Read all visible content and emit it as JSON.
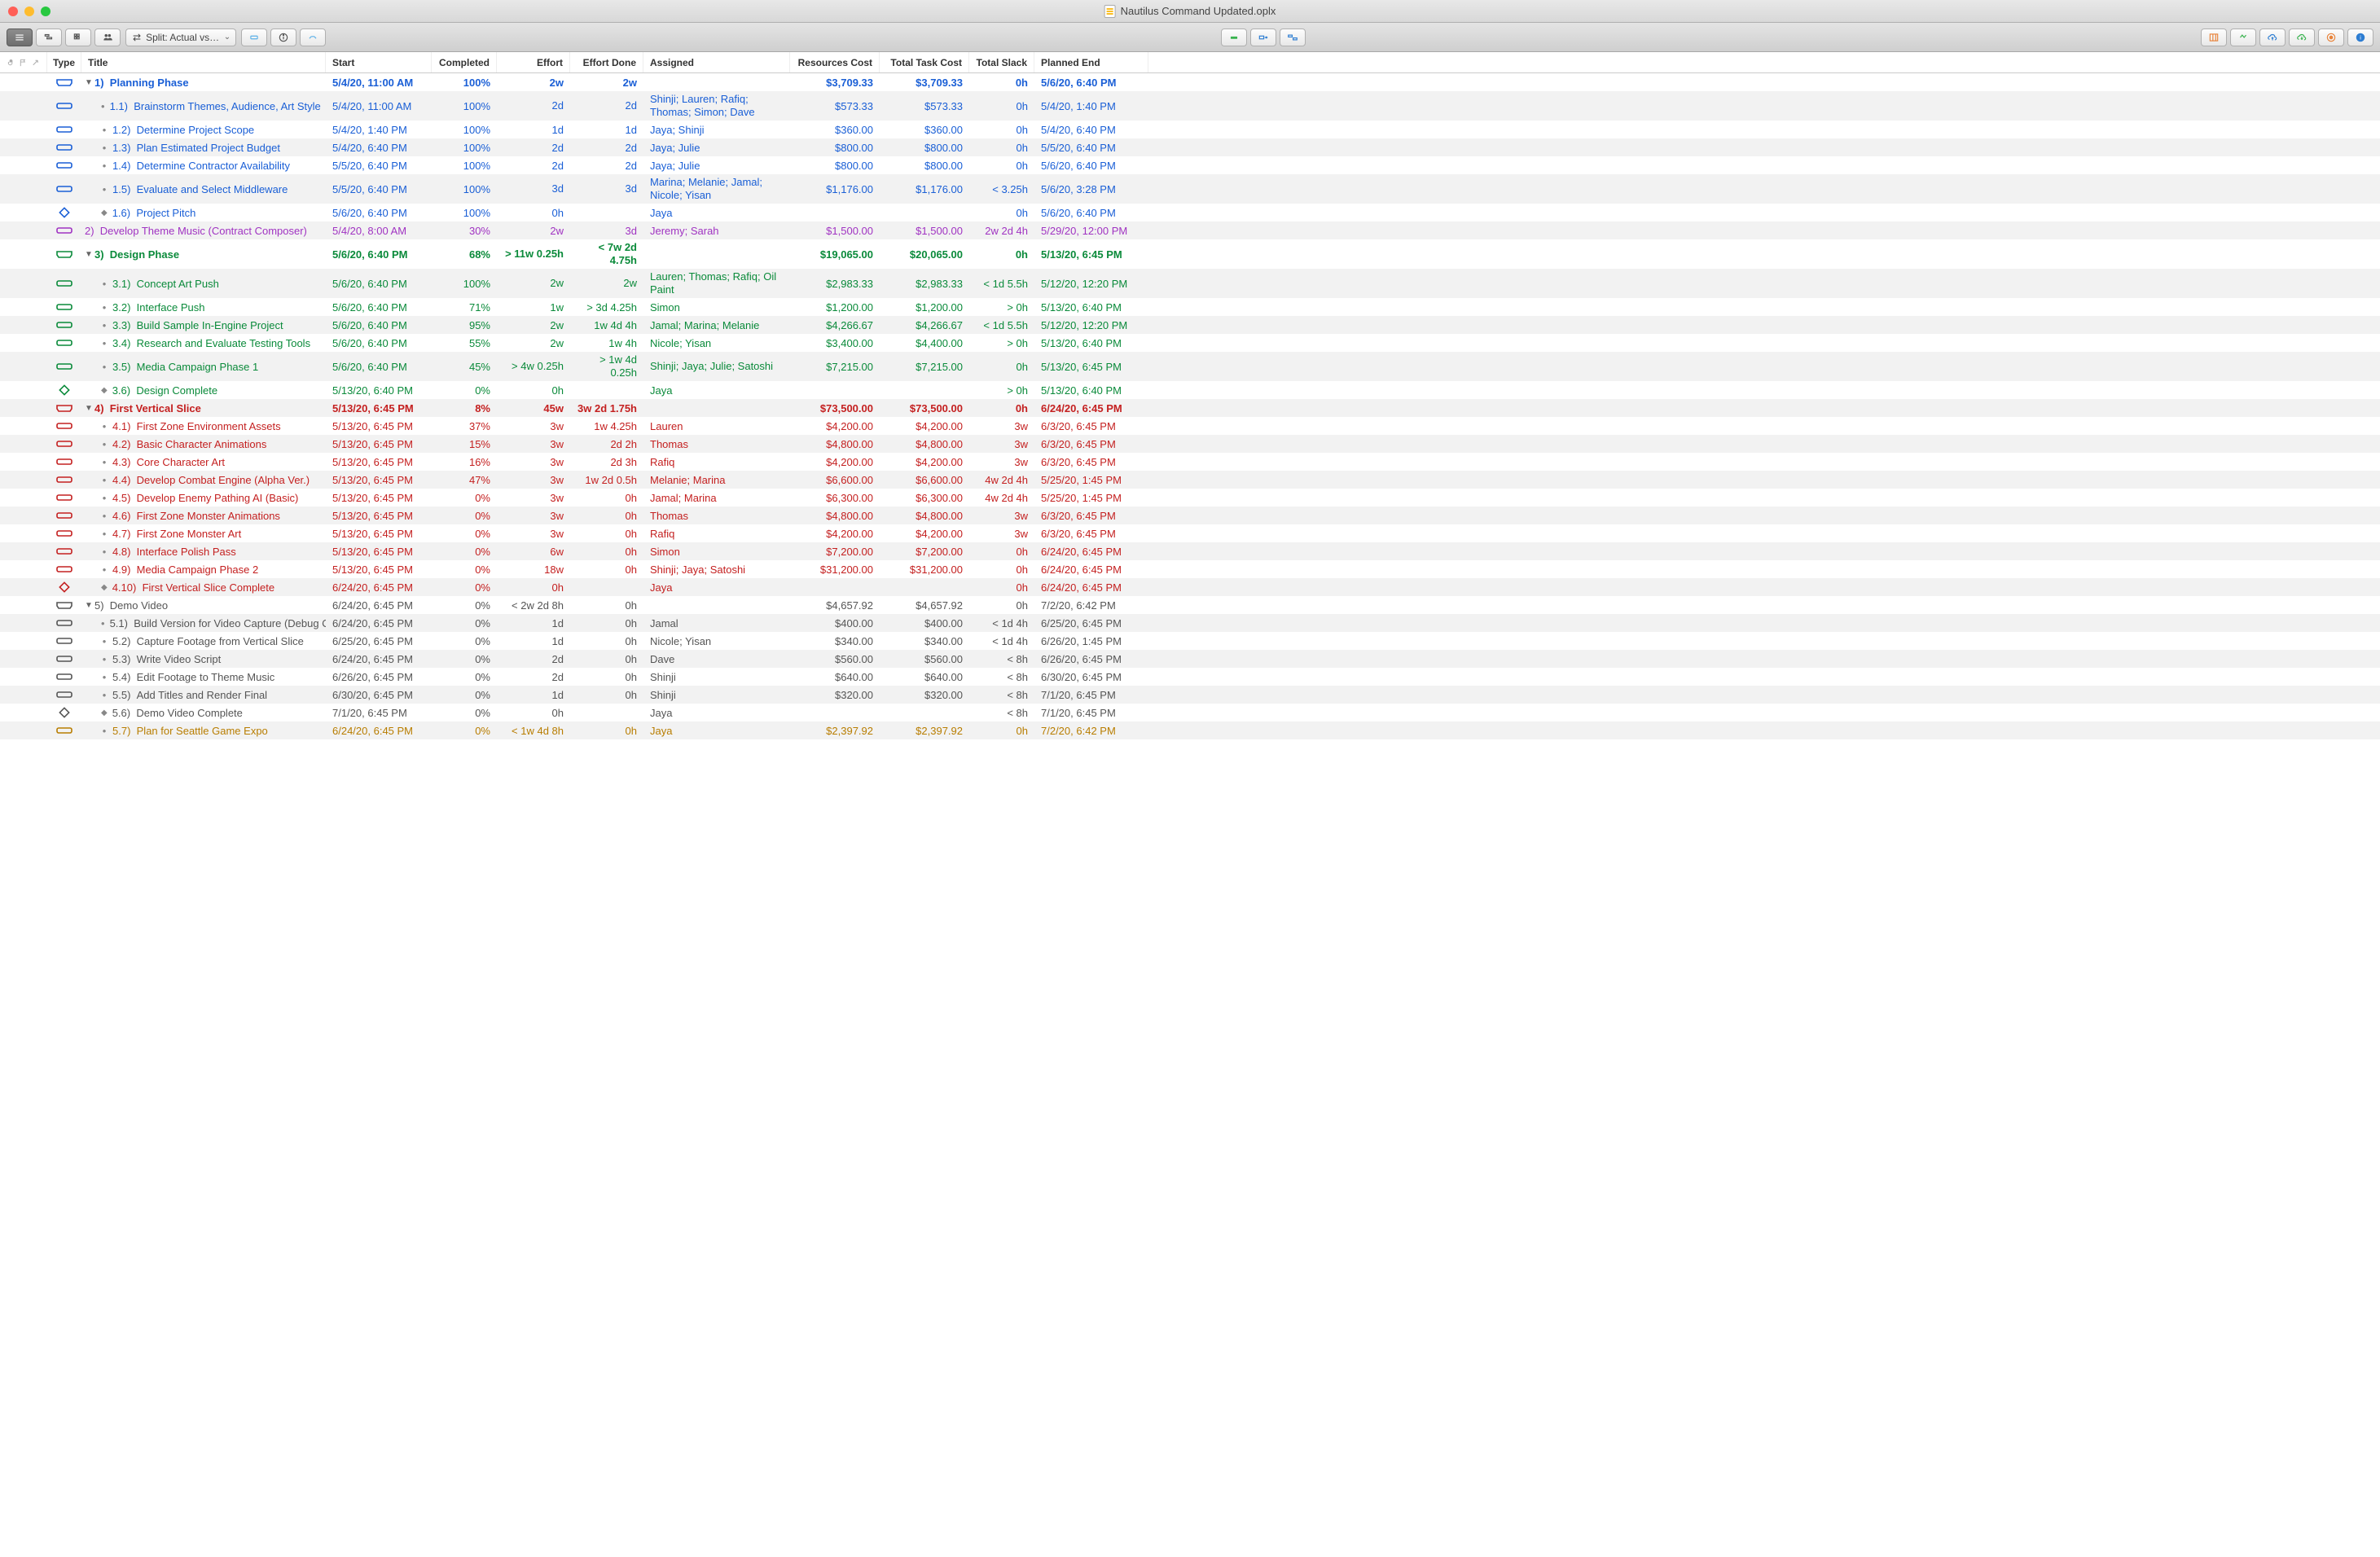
{
  "window": {
    "title": "Nautilus Command Updated.oplx"
  },
  "toolbar": {
    "split_label": "Split: Actual vs…"
  },
  "columns": {
    "type": "Type",
    "title": "Title",
    "start": "Start",
    "completed": "Completed",
    "effort": "Effort",
    "effort_done": "Effort Done",
    "assigned": "Assigned",
    "resources_cost": "Resources Cost",
    "total_task_cost": "Total Task Cost",
    "total_slack": "Total Slack",
    "planned_end": "Planned End"
  },
  "rows": [
    {
      "id": "1",
      "kind": "group",
      "color": "blue",
      "bold": true,
      "level": 1,
      "disclosure": "down",
      "number": "1)",
      "title": "Planning Phase",
      "start": "5/4/20, 11:00 AM",
      "completed": "100%",
      "effort": "2w",
      "effort_done": "2w",
      "assigned": "",
      "res_cost": "$3,709.33",
      "task_cost": "$3,709.33",
      "slack": "0h",
      "end": "5/6/20, 6:40 PM",
      "tall": false
    },
    {
      "id": "1.1",
      "kind": "task",
      "color": "blue",
      "level": 2,
      "bullet": "dot",
      "number": "1.1)",
      "title": "Brainstorm Themes, Audience, Art Style",
      "start": "5/4/20, 11:00 AM",
      "completed": "100%",
      "effort": "2d",
      "effort_done": "2d",
      "assigned": "Shinji; Lauren; Rafiq; Thomas; Simon; Dave",
      "res_cost": "$573.33",
      "task_cost": "$573.33",
      "slack": "0h",
      "end": "5/4/20, 1:40 PM",
      "tall": true
    },
    {
      "id": "1.2",
      "kind": "task",
      "color": "blue",
      "level": 2,
      "bullet": "dot",
      "number": "1.2)",
      "title": "Determine Project Scope",
      "start": "5/4/20, 1:40 PM",
      "completed": "100%",
      "effort": "1d",
      "effort_done": "1d",
      "assigned": "Jaya; Shinji",
      "res_cost": "$360.00",
      "task_cost": "$360.00",
      "slack": "0h",
      "end": "5/4/20, 6:40 PM",
      "tall": false
    },
    {
      "id": "1.3",
      "kind": "task",
      "color": "blue",
      "level": 2,
      "bullet": "dot",
      "number": "1.3)",
      "title": "Plan Estimated Project Budget",
      "start": "5/4/20, 6:40 PM",
      "completed": "100%",
      "effort": "2d",
      "effort_done": "2d",
      "assigned": "Jaya; Julie",
      "res_cost": "$800.00",
      "task_cost": "$800.00",
      "slack": "0h",
      "end": "5/5/20, 6:40 PM",
      "tall": false
    },
    {
      "id": "1.4",
      "kind": "task",
      "color": "blue",
      "level": 2,
      "bullet": "dot",
      "number": "1.4)",
      "title": "Determine Contractor Availability",
      "start": "5/5/20, 6:40 PM",
      "completed": "100%",
      "effort": "2d",
      "effort_done": "2d",
      "assigned": "Jaya; Julie",
      "res_cost": "$800.00",
      "task_cost": "$800.00",
      "slack": "0h",
      "end": "5/6/20, 6:40 PM",
      "tall": false
    },
    {
      "id": "1.5",
      "kind": "task",
      "color": "blue",
      "level": 2,
      "bullet": "dot",
      "number": "1.5)",
      "title": "Evaluate and Select Middleware",
      "start": "5/5/20, 6:40 PM",
      "completed": "100%",
      "effort": "3d",
      "effort_done": "3d",
      "assigned": "Marina; Melanie; Jamal; Nicole; Yisan",
      "res_cost": "$1,176.00",
      "task_cost": "$1,176.00",
      "slack": "< 3.25h",
      "end": "5/6/20, 3:28 PM",
      "tall": true
    },
    {
      "id": "1.6",
      "kind": "milestone",
      "color": "blue",
      "level": 2,
      "bullet": "diamond",
      "number": "1.6)",
      "title": "Project Pitch",
      "start": "5/6/20, 6:40 PM",
      "completed": "100%",
      "effort": "0h",
      "effort_done": "",
      "assigned": "Jaya",
      "res_cost": "",
      "task_cost": "",
      "slack": "0h",
      "end": "5/6/20, 6:40 PM",
      "tall": false
    },
    {
      "id": "2",
      "kind": "task",
      "color": "purple",
      "level": 1,
      "disclosure": "none",
      "bullet": "none",
      "number": "2)",
      "title": "Develop Theme Music (Contract Composer)",
      "start": "5/4/20, 8:00 AM",
      "completed": "30%",
      "effort": "2w",
      "effort_done": "3d",
      "assigned": "Jeremy; Sarah",
      "res_cost": "$1,500.00",
      "task_cost": "$1,500.00",
      "slack": "2w 2d 4h",
      "end": "5/29/20, 12:00 PM",
      "tall": false
    },
    {
      "id": "3",
      "kind": "group",
      "color": "green",
      "bold": true,
      "level": 1,
      "disclosure": "down",
      "number": "3)",
      "title": "Design Phase",
      "start": "5/6/20, 6:40 PM",
      "completed": "68%",
      "effort": "> 11w 0.25h",
      "effort_done": "< 7w 2d 4.75h",
      "assigned": "",
      "res_cost": "$19,065.00",
      "task_cost": "$20,065.00",
      "slack": "0h",
      "end": "5/13/20, 6:45 PM",
      "tall": true
    },
    {
      "id": "3.1",
      "kind": "task",
      "color": "green",
      "level": 2,
      "bullet": "dot",
      "number": "3.1)",
      "title": "Concept Art Push",
      "start": "5/6/20, 6:40 PM",
      "completed": "100%",
      "effort": "2w",
      "effort_done": "2w",
      "assigned": "Lauren; Thomas; Rafiq; Oil Paint",
      "res_cost": "$2,983.33",
      "task_cost": "$2,983.33",
      "slack": "< 1d 5.5h",
      "end": "5/12/20, 12:20 PM",
      "tall": true
    },
    {
      "id": "3.2",
      "kind": "task",
      "color": "green",
      "level": 2,
      "bullet": "dot",
      "number": "3.2)",
      "title": "Interface Push",
      "start": "5/6/20, 6:40 PM",
      "completed": "71%",
      "effort": "1w",
      "effort_done": "> 3d 4.25h",
      "assigned": "Simon",
      "res_cost": "$1,200.00",
      "task_cost": "$1,200.00",
      "slack": "> 0h",
      "end": "5/13/20, 6:40 PM",
      "tall": false
    },
    {
      "id": "3.3",
      "kind": "task",
      "color": "green",
      "level": 2,
      "bullet": "dot",
      "number": "3.3)",
      "title": "Build Sample In-Engine Project",
      "start": "5/6/20, 6:40 PM",
      "completed": "95%",
      "effort": "2w",
      "effort_done": "1w 4d 4h",
      "assigned": "Jamal; Marina; Melanie",
      "res_cost": "$4,266.67",
      "task_cost": "$4,266.67",
      "slack": "< 1d 5.5h",
      "end": "5/12/20, 12:20 PM",
      "tall": false
    },
    {
      "id": "3.4",
      "kind": "task",
      "color": "green",
      "level": 2,
      "bullet": "dot",
      "number": "3.4)",
      "title": "Research and Evaluate Testing Tools",
      "start": "5/6/20, 6:40 PM",
      "completed": "55%",
      "effort": "2w",
      "effort_done": "1w 4h",
      "assigned": "Nicole; Yisan",
      "res_cost": "$3,400.00",
      "task_cost": "$4,400.00",
      "slack": "> 0h",
      "end": "5/13/20, 6:40 PM",
      "tall": false
    },
    {
      "id": "3.5",
      "kind": "task",
      "color": "green",
      "level": 2,
      "bullet": "dot",
      "number": "3.5)",
      "title": "Media Campaign Phase 1",
      "start": "5/6/20, 6:40 PM",
      "completed": "45%",
      "effort": "> 4w 0.25h",
      "effort_done": "> 1w 4d 0.25h",
      "assigned": "Shinji; Jaya; Julie; Satoshi",
      "res_cost": "$7,215.00",
      "task_cost": "$7,215.00",
      "slack": "0h",
      "end": "5/13/20, 6:45 PM",
      "tall": true
    },
    {
      "id": "3.6",
      "kind": "milestone",
      "color": "green",
      "level": 2,
      "bullet": "diamond",
      "number": "3.6)",
      "title": "Design Complete",
      "start": "5/13/20, 6:40 PM",
      "completed": "0%",
      "effort": "0h",
      "effort_done": "",
      "assigned": "Jaya",
      "res_cost": "",
      "task_cost": "",
      "slack": "> 0h",
      "end": "5/13/20, 6:40 PM",
      "tall": false
    },
    {
      "id": "4",
      "kind": "group",
      "color": "red",
      "bold": true,
      "level": 1,
      "disclosure": "down",
      "number": "4)",
      "title": "First Vertical Slice",
      "start": "5/13/20, 6:45 PM",
      "completed": "8%",
      "effort": "45w",
      "effort_done": "3w 2d 1.75h",
      "assigned": "",
      "res_cost": "$73,500.00",
      "task_cost": "$73,500.00",
      "slack": "0h",
      "end": "6/24/20, 6:45 PM",
      "tall": false
    },
    {
      "id": "4.1",
      "kind": "task",
      "color": "red",
      "level": 2,
      "bullet": "dot",
      "number": "4.1)",
      "title": "First Zone Environment Assets",
      "start": "5/13/20, 6:45 PM",
      "completed": "37%",
      "effort": "3w",
      "effort_done": "1w 4.25h",
      "assigned": "Lauren",
      "res_cost": "$4,200.00",
      "task_cost": "$4,200.00",
      "slack": "3w",
      "end": "6/3/20, 6:45 PM",
      "tall": false
    },
    {
      "id": "4.2",
      "kind": "task",
      "color": "red",
      "level": 2,
      "bullet": "dot",
      "number": "4.2)",
      "title": "Basic Character Animations",
      "start": "5/13/20, 6:45 PM",
      "completed": "15%",
      "effort": "3w",
      "effort_done": "2d 2h",
      "assigned": "Thomas",
      "res_cost": "$4,800.00",
      "task_cost": "$4,800.00",
      "slack": "3w",
      "end": "6/3/20, 6:45 PM",
      "tall": false
    },
    {
      "id": "4.3",
      "kind": "task",
      "color": "red",
      "level": 2,
      "bullet": "dot",
      "number": "4.3)",
      "title": "Core Character Art",
      "start": "5/13/20, 6:45 PM",
      "completed": "16%",
      "effort": "3w",
      "effort_done": "2d 3h",
      "assigned": "Rafiq",
      "res_cost": "$4,200.00",
      "task_cost": "$4,200.00",
      "slack": "3w",
      "end": "6/3/20, 6:45 PM",
      "tall": false
    },
    {
      "id": "4.4",
      "kind": "task",
      "color": "red",
      "level": 2,
      "bullet": "dot",
      "number": "4.4)",
      "title": "Develop Combat Engine (Alpha Ver.)",
      "start": "5/13/20, 6:45 PM",
      "completed": "47%",
      "effort": "3w",
      "effort_done": "1w 2d 0.5h",
      "assigned": "Melanie; Marina",
      "res_cost": "$6,600.00",
      "task_cost": "$6,600.00",
      "slack": "4w 2d 4h",
      "end": "5/25/20, 1:45 PM",
      "tall": false
    },
    {
      "id": "4.5",
      "kind": "task",
      "color": "red",
      "level": 2,
      "bullet": "dot",
      "number": "4.5)",
      "title": "Develop Enemy Pathing AI (Basic)",
      "start": "5/13/20, 6:45 PM",
      "completed": "0%",
      "effort": "3w",
      "effort_done": "0h",
      "assigned": "Jamal; Marina",
      "res_cost": "$6,300.00",
      "task_cost": "$6,300.00",
      "slack": "4w 2d 4h",
      "end": "5/25/20, 1:45 PM",
      "tall": false
    },
    {
      "id": "4.6",
      "kind": "task",
      "color": "red",
      "level": 2,
      "bullet": "dot",
      "number": "4.6)",
      "title": "First Zone Monster Animations",
      "start": "5/13/20, 6:45 PM",
      "completed": "0%",
      "effort": "3w",
      "effort_done": "0h",
      "assigned": "Thomas",
      "res_cost": "$4,800.00",
      "task_cost": "$4,800.00",
      "slack": "3w",
      "end": "6/3/20, 6:45 PM",
      "tall": false
    },
    {
      "id": "4.7",
      "kind": "task",
      "color": "red",
      "level": 2,
      "bullet": "dot",
      "number": "4.7)",
      "title": "First Zone Monster Art",
      "start": "5/13/20, 6:45 PM",
      "completed": "0%",
      "effort": "3w",
      "effort_done": "0h",
      "assigned": "Rafiq",
      "res_cost": "$4,200.00",
      "task_cost": "$4,200.00",
      "slack": "3w",
      "end": "6/3/20, 6:45 PM",
      "tall": false
    },
    {
      "id": "4.8",
      "kind": "task",
      "color": "red",
      "level": 2,
      "bullet": "dot",
      "number": "4.8)",
      "title": "Interface Polish Pass",
      "start": "5/13/20, 6:45 PM",
      "completed": "0%",
      "effort": "6w",
      "effort_done": "0h",
      "assigned": "Simon",
      "res_cost": "$7,200.00",
      "task_cost": "$7,200.00",
      "slack": "0h",
      "end": "6/24/20, 6:45 PM",
      "tall": false
    },
    {
      "id": "4.9",
      "kind": "task",
      "color": "red",
      "level": 2,
      "bullet": "dot",
      "number": "4.9)",
      "title": "Media Campaign Phase 2",
      "start": "5/13/20, 6:45 PM",
      "completed": "0%",
      "effort": "18w",
      "effort_done": "0h",
      "assigned": "Shinji; Jaya; Satoshi",
      "res_cost": "$31,200.00",
      "task_cost": "$31,200.00",
      "slack": "0h",
      "end": "6/24/20, 6:45 PM",
      "tall": false
    },
    {
      "id": "4.10",
      "kind": "milestone",
      "color": "red",
      "level": 2,
      "bullet": "diamond",
      "number": "4.10)",
      "title": "First Vertical Slice Complete",
      "start": "6/24/20, 6:45 PM",
      "completed": "0%",
      "effort": "0h",
      "effort_done": "",
      "assigned": "Jaya",
      "res_cost": "",
      "task_cost": "",
      "slack": "0h",
      "end": "6/24/20, 6:45 PM",
      "tall": false
    },
    {
      "id": "5",
      "kind": "group",
      "color": "gray",
      "bold": false,
      "level": 1,
      "disclosure": "down",
      "number": "5)",
      "title": "Demo Video",
      "start": "6/24/20, 6:45 PM",
      "completed": "0%",
      "effort": "< 2w 2d 8h",
      "effort_done": "0h",
      "assigned": "",
      "res_cost": "$4,657.92",
      "task_cost": "$4,657.92",
      "slack": "0h",
      "end": "7/2/20, 6:42 PM",
      "tall": false
    },
    {
      "id": "5.1",
      "kind": "task",
      "color": "gray",
      "level": 2,
      "bullet": "dot",
      "number": "5.1)",
      "title": "Build Version for Video Capture (Debug Off)",
      "start": "6/24/20, 6:45 PM",
      "completed": "0%",
      "effort": "1d",
      "effort_done": "0h",
      "assigned": "Jamal",
      "res_cost": "$400.00",
      "task_cost": "$400.00",
      "slack": "< 1d 4h",
      "end": "6/25/20, 6:45 PM",
      "tall": false
    },
    {
      "id": "5.2",
      "kind": "task",
      "color": "gray",
      "level": 2,
      "bullet": "dot",
      "number": "5.2)",
      "title": "Capture Footage from Vertical Slice",
      "start": "6/25/20, 6:45 PM",
      "completed": "0%",
      "effort": "1d",
      "effort_done": "0h",
      "assigned": "Nicole; Yisan",
      "res_cost": "$340.00",
      "task_cost": "$340.00",
      "slack": "< 1d 4h",
      "end": "6/26/20, 1:45 PM",
      "tall": false
    },
    {
      "id": "5.3",
      "kind": "task",
      "color": "gray",
      "level": 2,
      "bullet": "dot",
      "number": "5.3)",
      "title": "Write Video Script",
      "start": "6/24/20, 6:45 PM",
      "completed": "0%",
      "effort": "2d",
      "effort_done": "0h",
      "assigned": "Dave",
      "res_cost": "$560.00",
      "task_cost": "$560.00",
      "slack": "< 8h",
      "end": "6/26/20, 6:45 PM",
      "tall": false
    },
    {
      "id": "5.4",
      "kind": "task",
      "color": "gray",
      "level": 2,
      "bullet": "dot",
      "number": "5.4)",
      "title": "Edit Footage to Theme Music",
      "start": "6/26/20, 6:45 PM",
      "completed": "0%",
      "effort": "2d",
      "effort_done": "0h",
      "assigned": "Shinji",
      "res_cost": "$640.00",
      "task_cost": "$640.00",
      "slack": "< 8h",
      "end": "6/30/20, 6:45 PM",
      "tall": false
    },
    {
      "id": "5.5",
      "kind": "task",
      "color": "gray",
      "level": 2,
      "bullet": "dot",
      "number": "5.5)",
      "title": "Add Titles and Render Final",
      "start": "6/30/20, 6:45 PM",
      "completed": "0%",
      "effort": "1d",
      "effort_done": "0h",
      "assigned": "Shinji",
      "res_cost": "$320.00",
      "task_cost": "$320.00",
      "slack": "< 8h",
      "end": "7/1/20, 6:45 PM",
      "tall": false
    },
    {
      "id": "5.6",
      "kind": "milestone",
      "color": "gray",
      "level": 2,
      "bullet": "diamond",
      "number": "5.6)",
      "title": "Demo Video Complete",
      "start": "7/1/20, 6:45 PM",
      "completed": "0%",
      "effort": "0h",
      "effort_done": "",
      "assigned": "Jaya",
      "res_cost": "",
      "task_cost": "",
      "slack": "< 8h",
      "end": "7/1/20, 6:45 PM",
      "tall": false
    },
    {
      "id": "5.7",
      "kind": "task",
      "color": "amber",
      "level": 2,
      "bullet": "dot",
      "number": "5.7)",
      "title": "Plan for Seattle Game Expo",
      "start": "6/24/20, 6:45 PM",
      "completed": "0%",
      "effort": "< 1w 4d 8h",
      "effort_done": "0h",
      "assigned": "Jaya",
      "res_cost": "$2,397.92",
      "task_cost": "$2,397.92",
      "slack": "0h",
      "end": "7/2/20, 6:42 PM",
      "tall": false
    }
  ]
}
